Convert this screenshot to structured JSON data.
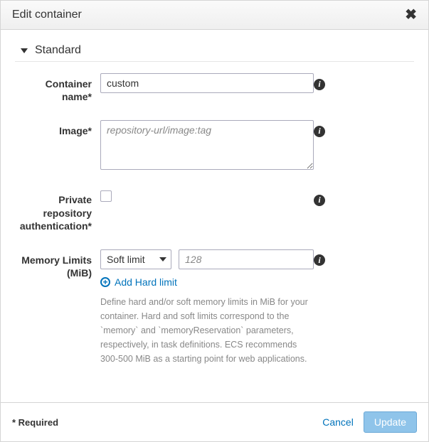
{
  "dialog": {
    "title": "Edit container",
    "close_symbol": "✖"
  },
  "section": {
    "title": "Standard"
  },
  "fields": {
    "container_name": {
      "label": "Container name*",
      "value": "custom"
    },
    "image": {
      "label": "Image*",
      "placeholder": "repository-url/image:tag",
      "value": ""
    },
    "private_repo": {
      "label": "Private repository authentication*",
      "checked": false
    },
    "memory": {
      "label": "Memory Limits (MiB)",
      "select_value": "Soft limit",
      "input_placeholder": "128",
      "add_link": "Add Hard limit",
      "help": "Define hard and/or soft memory limits in MiB for your container. Hard and soft limits correspond to the `memory` and `memoryReservation` parameters, respectively, in task definitions.\nECS recommends 300-500 MiB as a starting point for web applications."
    }
  },
  "footer": {
    "required": "* Required",
    "cancel": "Cancel",
    "update": "Update"
  }
}
